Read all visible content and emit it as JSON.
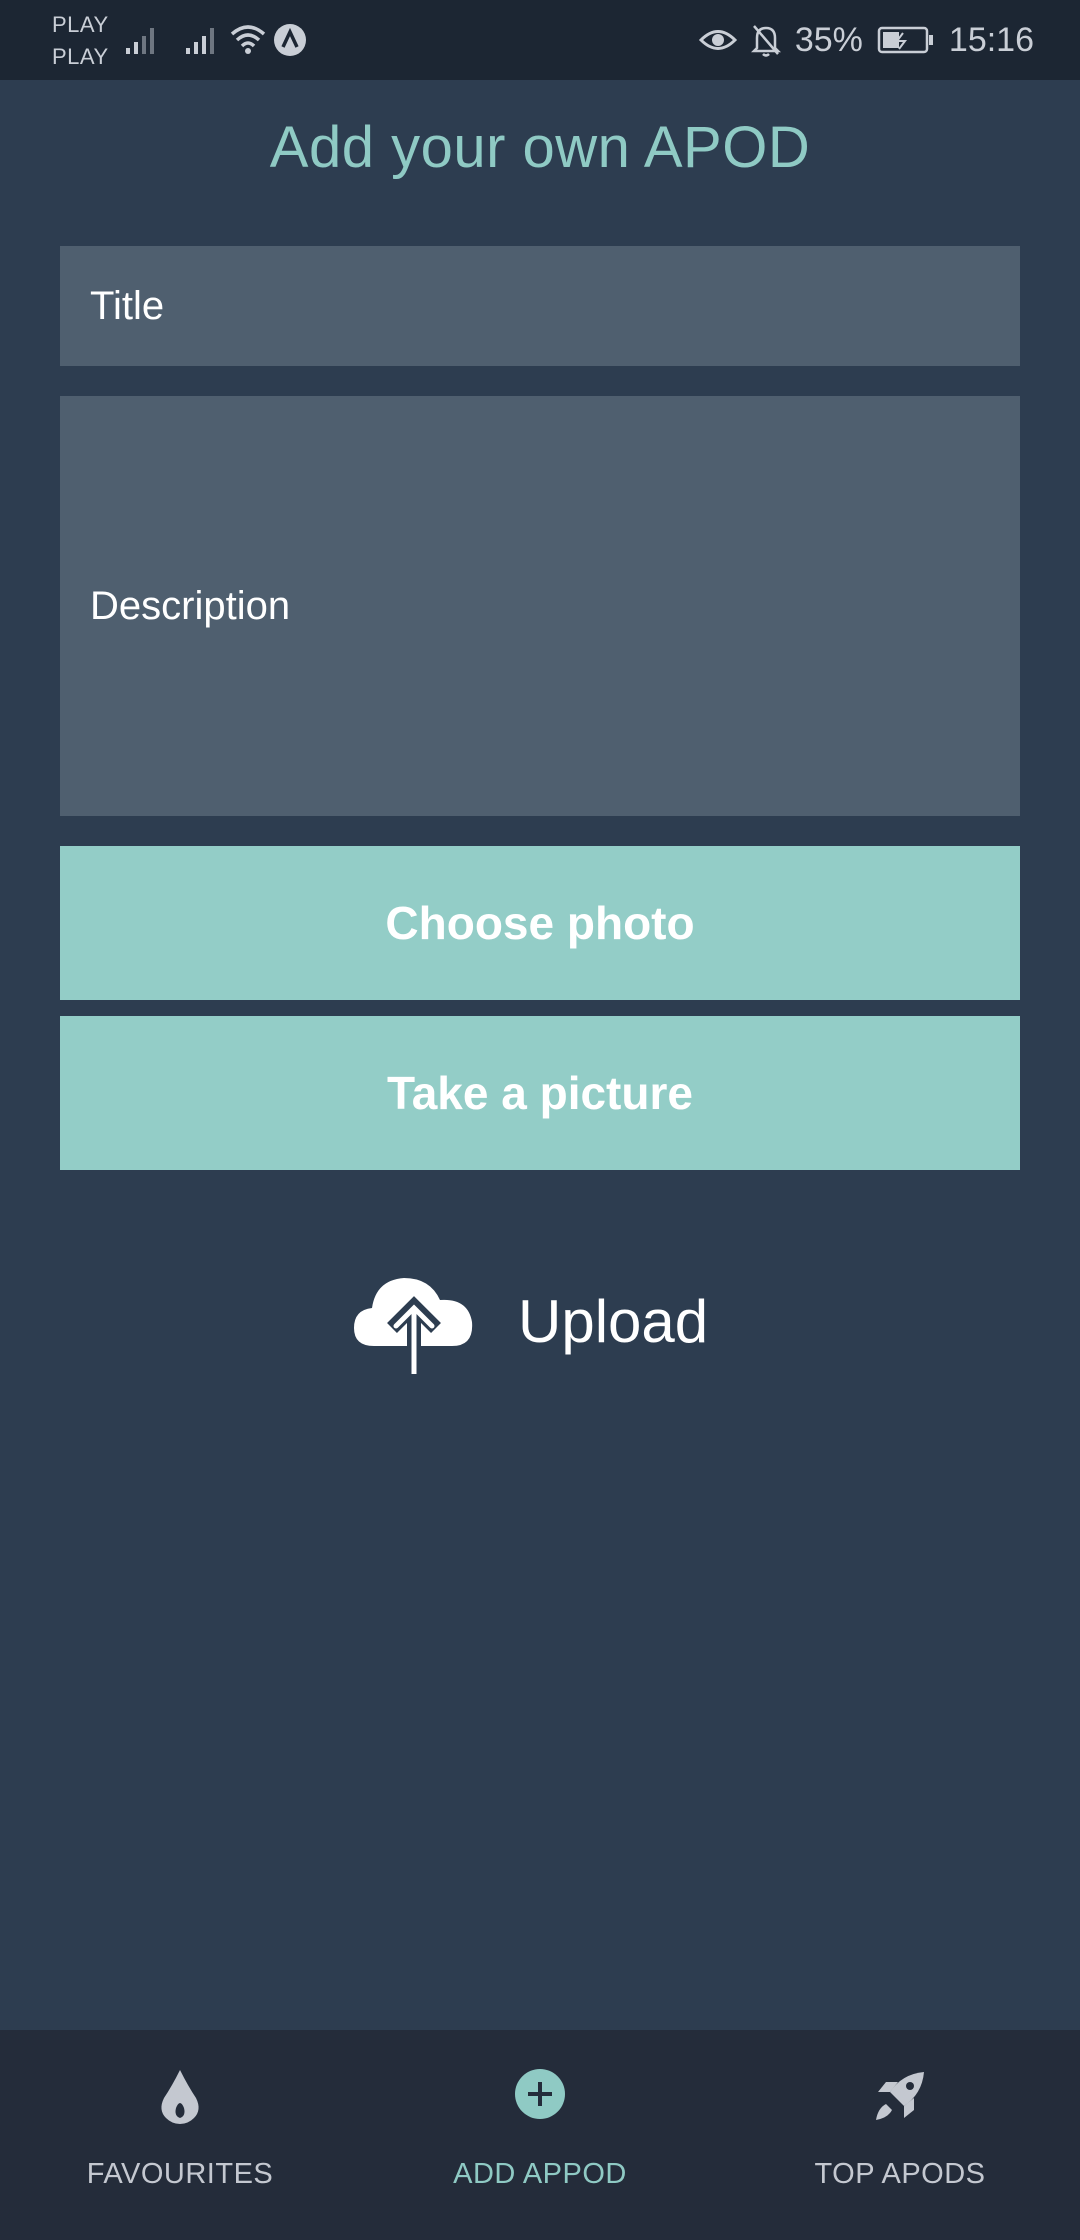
{
  "status_bar": {
    "carrier_1": "PLAY",
    "carrier_2": "PLAY",
    "battery": "35%",
    "time": "15:16",
    "icons": [
      "signal-icon",
      "signal-icon",
      "wifi-icon",
      "app-notification-icon",
      "eye-icon",
      "bell-off-icon",
      "battery-icon"
    ]
  },
  "page": {
    "title": "Add your own APOD"
  },
  "form": {
    "title_placeholder": "Title",
    "description_placeholder": "Description",
    "choose_photo": "Choose photo",
    "take_picture": "Take a picture",
    "upload": "Upload"
  },
  "colors": {
    "background": "#2d3d50",
    "accent": "#8fcac4",
    "button": "#93cdc7",
    "field": "#4f5f6f",
    "nav": "#242c3a"
  },
  "nav": {
    "items": [
      {
        "label": "FAVOURITES",
        "icon": "flame-icon",
        "active": false
      },
      {
        "label": "ADD APPOD",
        "icon": "plus-circle-icon",
        "active": true
      },
      {
        "label": "TOP APODS",
        "icon": "rocket-icon",
        "active": false
      }
    ]
  }
}
